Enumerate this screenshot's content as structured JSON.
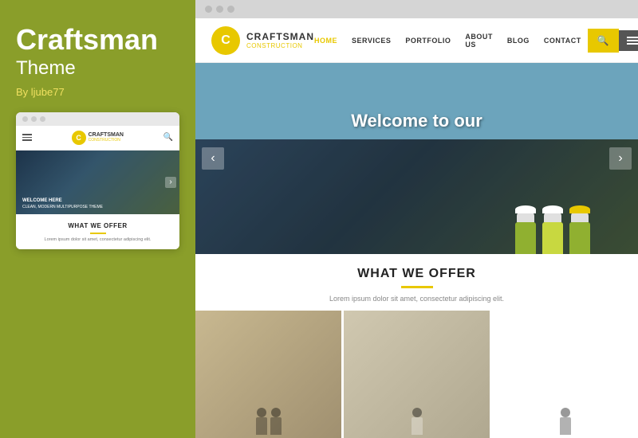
{
  "left": {
    "title": "Craftsman",
    "subtitle": "Theme",
    "by": "By ljube77",
    "mini": {
      "logo": "C",
      "logo_name": "CRAFTSMAN",
      "logo_sub": "CONSTRUCTION",
      "hero_text": "WELCOME HERE",
      "hero_sub": "CLEAN, MODERN MULTIPURPOSE THEME",
      "section_title": "WHAT WE OFFER",
      "section_text": "Lorem ipsum dolor sit amet, consectetur adipiscing elit."
    }
  },
  "right": {
    "browser_dots": [
      "dot1",
      "dot2",
      "dot3"
    ],
    "header": {
      "logo": "C",
      "logo_name": "CRAFTSMAN",
      "logo_tagline": "CONSTRUCTION",
      "nav": [
        {
          "label": "HOME",
          "active": true
        },
        {
          "label": "SERVICES",
          "active": false
        },
        {
          "label": "PORTFOLIO",
          "active": false
        },
        {
          "label": "ABOUT US",
          "active": false
        },
        {
          "label": "BLOG",
          "active": false
        },
        {
          "label": "CONTACT",
          "active": false
        }
      ]
    },
    "hero": {
      "welcome_text": "Welcome to our",
      "prev_icon": "‹",
      "next_icon": "›"
    },
    "offer": {
      "title": "WHAT WE OFFER",
      "text": "Lorem ipsum dolor sit amet, consectetur adipiscing elit."
    }
  }
}
